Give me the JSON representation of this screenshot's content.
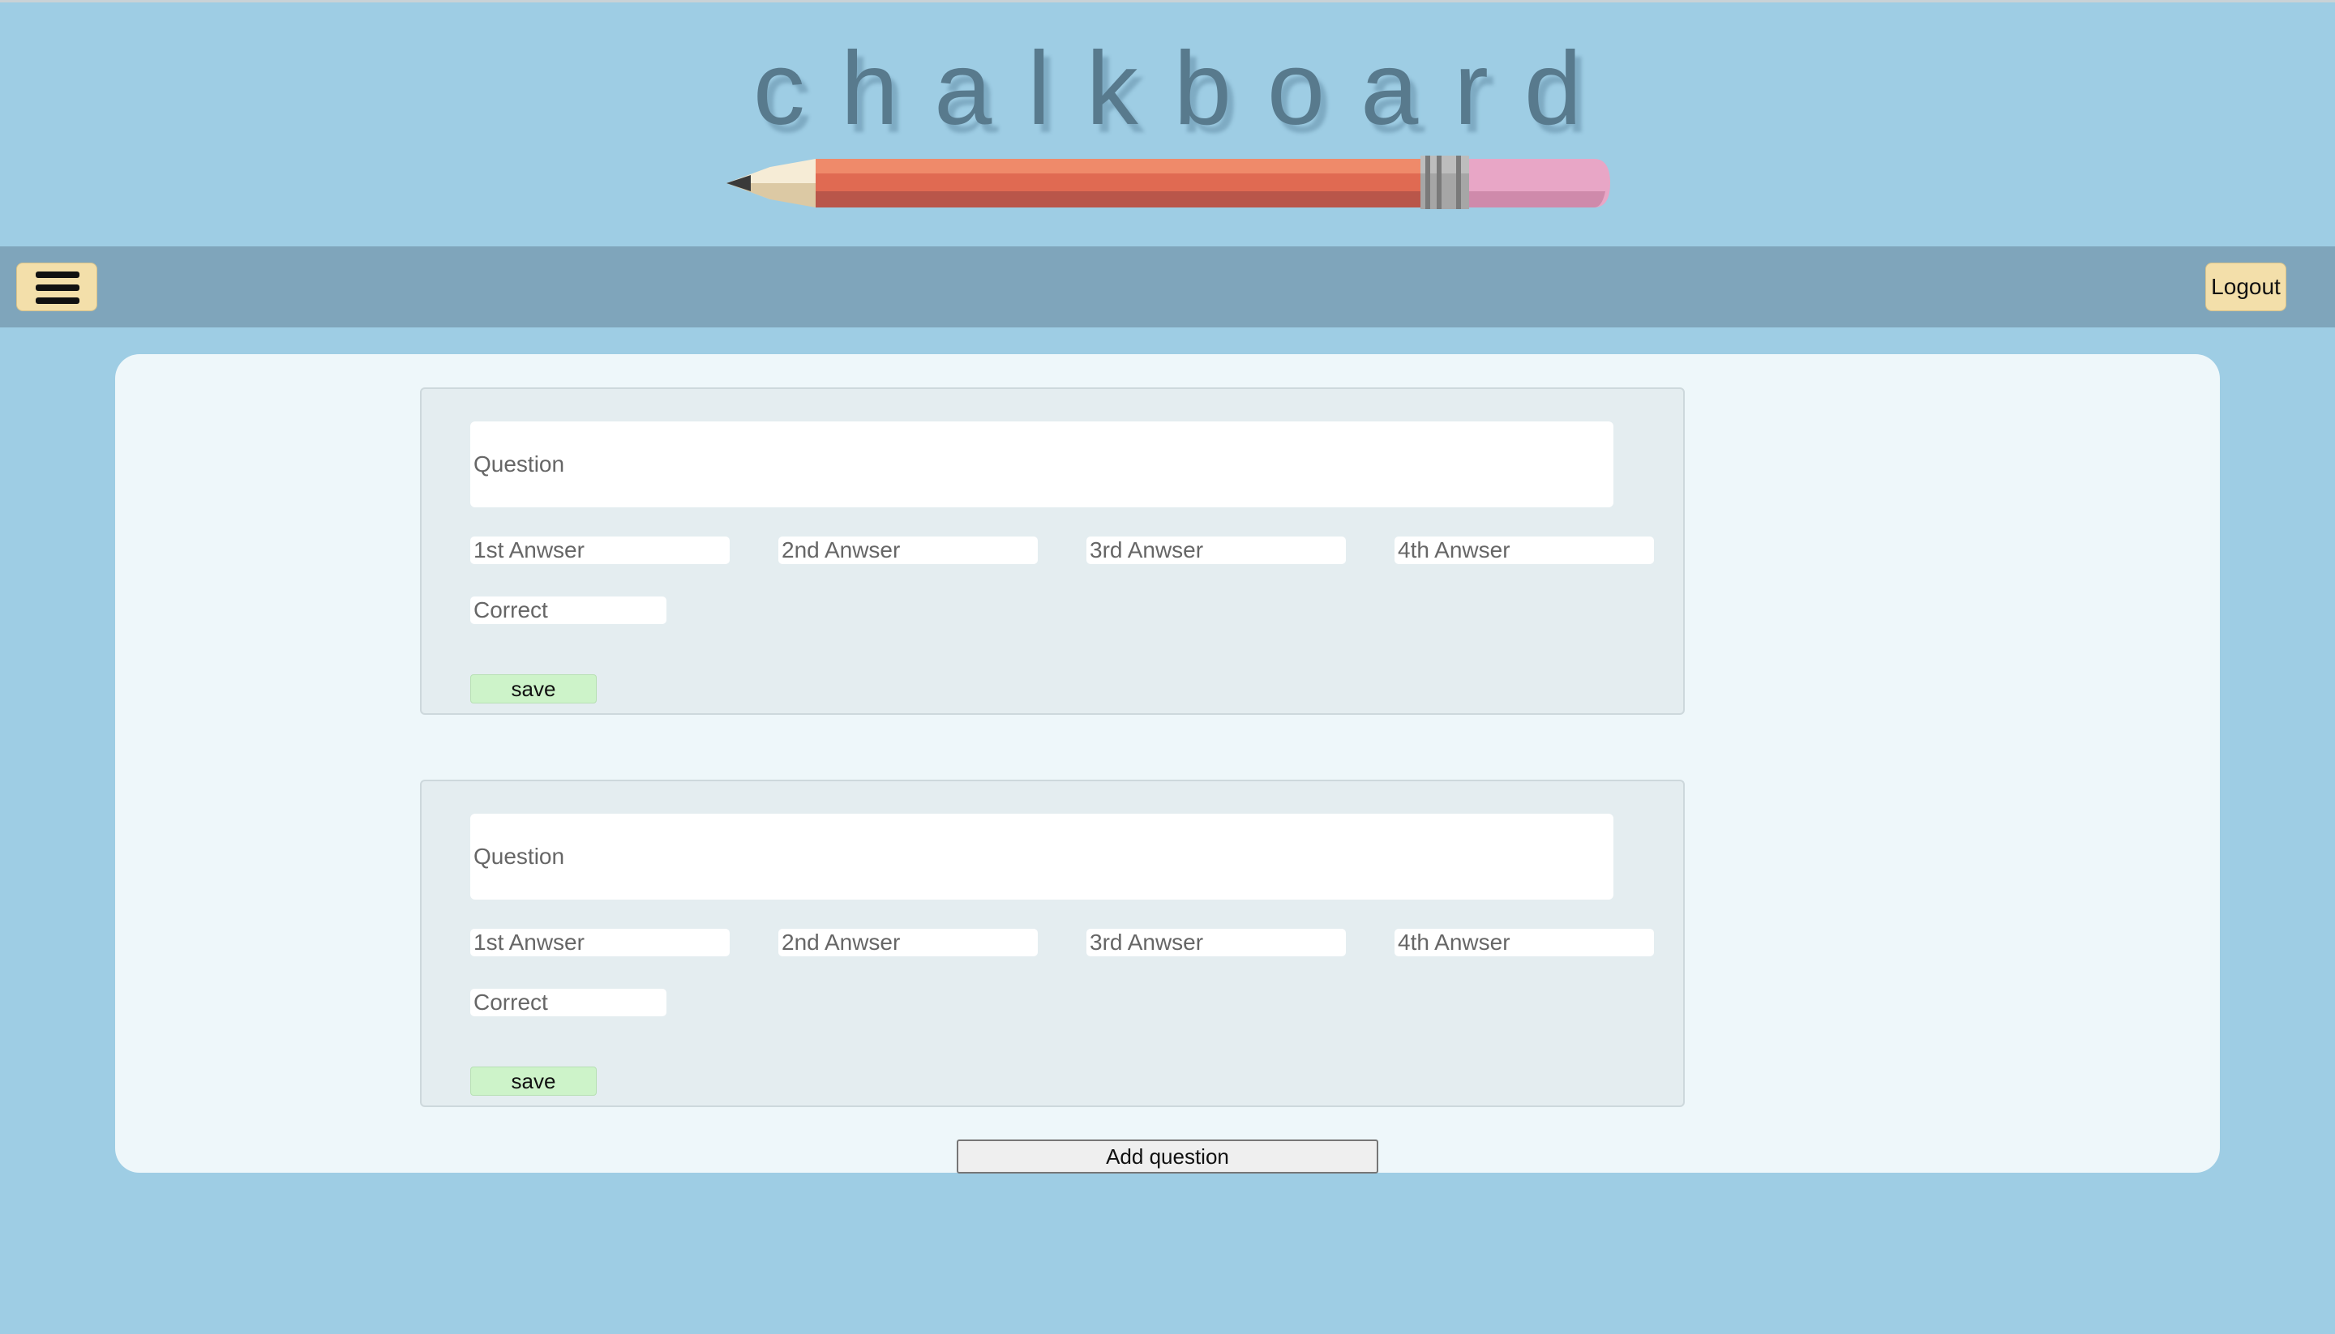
{
  "app": {
    "logo_text": "chalkboard"
  },
  "navbar": {
    "menu_icon": "hamburger-menu-icon",
    "logout_label": "Logout"
  },
  "questions": [
    {
      "question_placeholder": "Question",
      "answers": [
        "1st Anwser",
        "2nd Anwser",
        "3rd Anwser",
        "4th Anwser"
      ],
      "correct_placeholder": "Correct",
      "save_label": "save"
    },
    {
      "question_placeholder": "Question",
      "answers": [
        "1st Anwser",
        "2nd Anwser",
        "3rd Anwser",
        "4th Anwser"
      ],
      "correct_placeholder": "Correct",
      "save_label": "save"
    }
  ],
  "add_question_label": "Add question",
  "colors": {
    "background": "#9ecde4",
    "navbar": "#7fa5bb",
    "button_cream": "#f3dfaa",
    "save_green": "#cdf3c9"
  }
}
